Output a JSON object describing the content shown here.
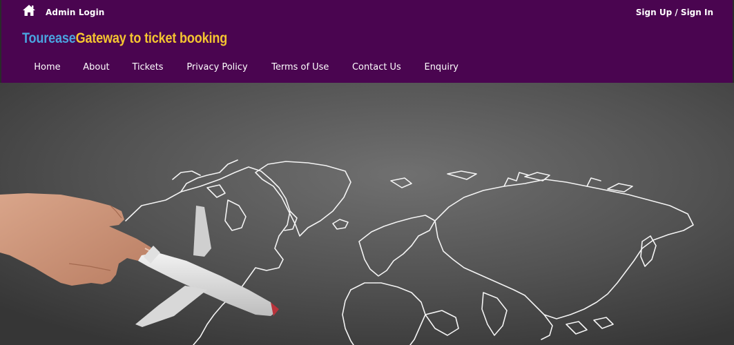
{
  "topbar": {
    "home_icon": "home-icon",
    "admin_login": "Admin Login",
    "signin": "Sign Up / Sign In"
  },
  "brand": {
    "name": "Tourease",
    "tagline": "Gateway to ticket booking",
    "name_color": "#4aa3df",
    "tagline_color": "#f5c530"
  },
  "nav": {
    "items": [
      {
        "label": "Home"
      },
      {
        "label": "About"
      },
      {
        "label": "Tickets"
      },
      {
        "label": "Privacy Policy"
      },
      {
        "label": "Terms of Use"
      },
      {
        "label": "Contact Us"
      },
      {
        "label": "Enquiry"
      }
    ]
  },
  "colors": {
    "header_bg": "#4a0550",
    "hero_bg": "#545454"
  }
}
